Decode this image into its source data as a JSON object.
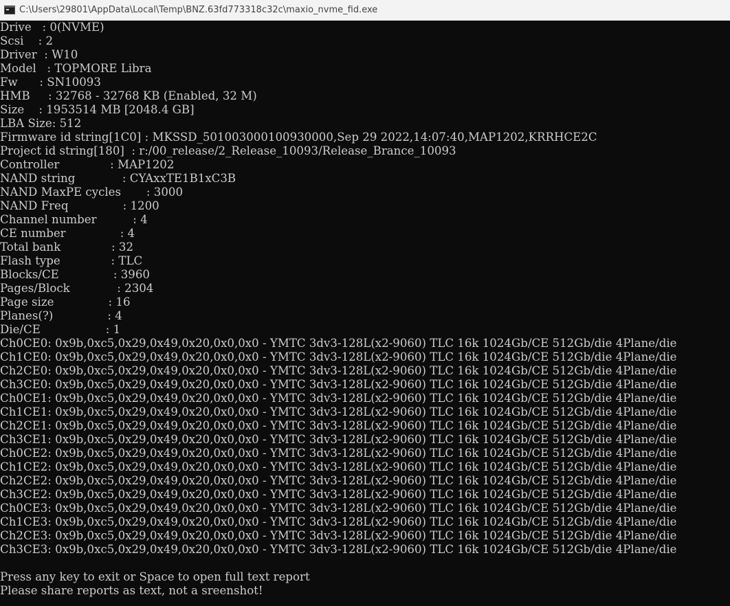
{
  "window": {
    "title": "C:\\Users\\29801\\AppData\\Local\\Temp\\BNZ.63fd773318c32c\\maxio_nvme_fid.exe"
  },
  "console": {
    "lines": [
      "Drive   : 0(NVME)",
      "Scsi    : 2",
      "Driver  : W10",
      "Model   : TOPMORE Libra",
      "Fw      : SN10093",
      "HMB     : 32768 - 32768 KB (Enabled, 32 M)",
      "Size    : 1953514 MB [2048.4 GB]",
      "LBA Size: 512",
      "Firmware id string[1C0] : MKSSD_501003000100930000,Sep 29 2022,14:07:40,MAP1202,KRRHCE2C",
      "Project id string[180]  : r:/00_release/2_Release_10093/Release_Brance_10093",
      "Controller              : MAP1202",
      "NAND string             : CYAxxTE1B1xC3B",
      "NAND MaxPE cycles       : 3000",
      "NAND Freq               : 1200",
      "Channel number          : 4",
      "CE number               : 4",
      "Total bank              : 32",
      "Flash type              : TLC",
      "Blocks/CE               : 3960",
      "Pages/Block             : 2304",
      "Page size               : 16",
      "Planes(?)               : 4",
      "Die/CE                  : 1",
      "Ch0CE0: 0x9b,0xc5,0x29,0x49,0x20,0x0,0x0 - YMTC 3dv3-128L(x2-9060) TLC 16k 1024Gb/CE 512Gb/die 4Plane/die",
      "Ch1CE0: 0x9b,0xc5,0x29,0x49,0x20,0x0,0x0 - YMTC 3dv3-128L(x2-9060) TLC 16k 1024Gb/CE 512Gb/die 4Plane/die",
      "Ch2CE0: 0x9b,0xc5,0x29,0x49,0x20,0x0,0x0 - YMTC 3dv3-128L(x2-9060) TLC 16k 1024Gb/CE 512Gb/die 4Plane/die",
      "Ch3CE0: 0x9b,0xc5,0x29,0x49,0x20,0x0,0x0 - YMTC 3dv3-128L(x2-9060) TLC 16k 1024Gb/CE 512Gb/die 4Plane/die",
      "Ch0CE1: 0x9b,0xc5,0x29,0x49,0x20,0x0,0x0 - YMTC 3dv3-128L(x2-9060) TLC 16k 1024Gb/CE 512Gb/die 4Plane/die",
      "Ch1CE1: 0x9b,0xc5,0x29,0x49,0x20,0x0,0x0 - YMTC 3dv3-128L(x2-9060) TLC 16k 1024Gb/CE 512Gb/die 4Plane/die",
      "Ch2CE1: 0x9b,0xc5,0x29,0x49,0x20,0x0,0x0 - YMTC 3dv3-128L(x2-9060) TLC 16k 1024Gb/CE 512Gb/die 4Plane/die",
      "Ch3CE1: 0x9b,0xc5,0x29,0x49,0x20,0x0,0x0 - YMTC 3dv3-128L(x2-9060) TLC 16k 1024Gb/CE 512Gb/die 4Plane/die",
      "Ch0CE2: 0x9b,0xc5,0x29,0x49,0x20,0x0,0x0 - YMTC 3dv3-128L(x2-9060) TLC 16k 1024Gb/CE 512Gb/die 4Plane/die",
      "Ch1CE2: 0x9b,0xc5,0x29,0x49,0x20,0x0,0x0 - YMTC 3dv3-128L(x2-9060) TLC 16k 1024Gb/CE 512Gb/die 4Plane/die",
      "Ch2CE2: 0x9b,0xc5,0x29,0x49,0x20,0x0,0x0 - YMTC 3dv3-128L(x2-9060) TLC 16k 1024Gb/CE 512Gb/die 4Plane/die",
      "Ch3CE2: 0x9b,0xc5,0x29,0x49,0x20,0x0,0x0 - YMTC 3dv3-128L(x2-9060) TLC 16k 1024Gb/CE 512Gb/die 4Plane/die",
      "Ch0CE3: 0x9b,0xc5,0x29,0x49,0x20,0x0,0x0 - YMTC 3dv3-128L(x2-9060) TLC 16k 1024Gb/CE 512Gb/die 4Plane/die",
      "Ch1CE3: 0x9b,0xc5,0x29,0x49,0x20,0x0,0x0 - YMTC 3dv3-128L(x2-9060) TLC 16k 1024Gb/CE 512Gb/die 4Plane/die",
      "Ch2CE3: 0x9b,0xc5,0x29,0x49,0x20,0x0,0x0 - YMTC 3dv3-128L(x2-9060) TLC 16k 1024Gb/CE 512Gb/die 4Plane/die",
      "Ch3CE3: 0x9b,0xc5,0x29,0x49,0x20,0x0,0x0 - YMTC 3dv3-128L(x2-9060) TLC 16k 1024Gb/CE 512Gb/die 4Plane/die",
      "",
      "Press any key to exit or Space to open full text report",
      "Please share reports as text, not a sreenshot!"
    ]
  },
  "icons": {
    "title": "console-app-icon"
  },
  "colors": {
    "console_background": "#0c0c0c",
    "console_text": "#cccccc",
    "titlebar_background": "#f3f3f3",
    "titlebar_text": "#444444"
  }
}
